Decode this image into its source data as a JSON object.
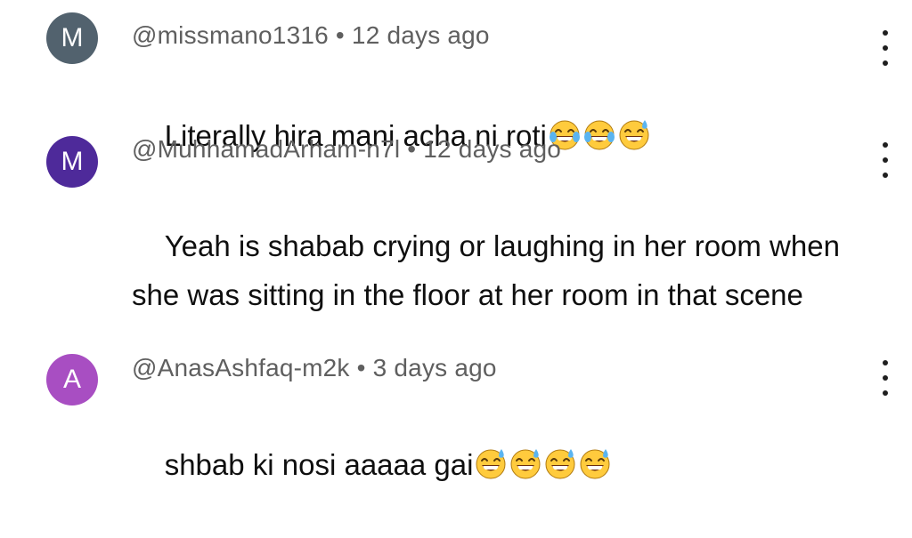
{
  "comments": [
    {
      "avatar_initial": "M",
      "avatar_color": "#52626e",
      "handle": "@missmano1316",
      "separator": "•",
      "time": "12 days ago",
      "text": "Literally hira mani acha ni roti",
      "emojis": [
        "face-with-tears-of-joy",
        "face-with-tears-of-joy",
        "grinning-face-with-sweat"
      ]
    },
    {
      "avatar_initial": "M",
      "avatar_color": "#4e2a9a",
      "handle": "@MuhhamadArham-n7l",
      "separator": "•",
      "time": "12 days ago",
      "text": "Yeah is shabab crying or laughing in her room when she was sitting in the floor at her room in that scene",
      "emojis": []
    },
    {
      "avatar_initial": "A",
      "avatar_color": "#a84ec2",
      "handle": "@AnasAshfaq-m2k",
      "separator": "•",
      "time": "3 days ago",
      "text": "shbab ki nosi aaaaa gai",
      "emojis": [
        "grinning-face-with-sweat",
        "grinning-face-with-sweat",
        "grinning-face-with-sweat",
        "grinning-face-with-sweat"
      ]
    }
  ],
  "more_icon": "more-vertical-icon"
}
